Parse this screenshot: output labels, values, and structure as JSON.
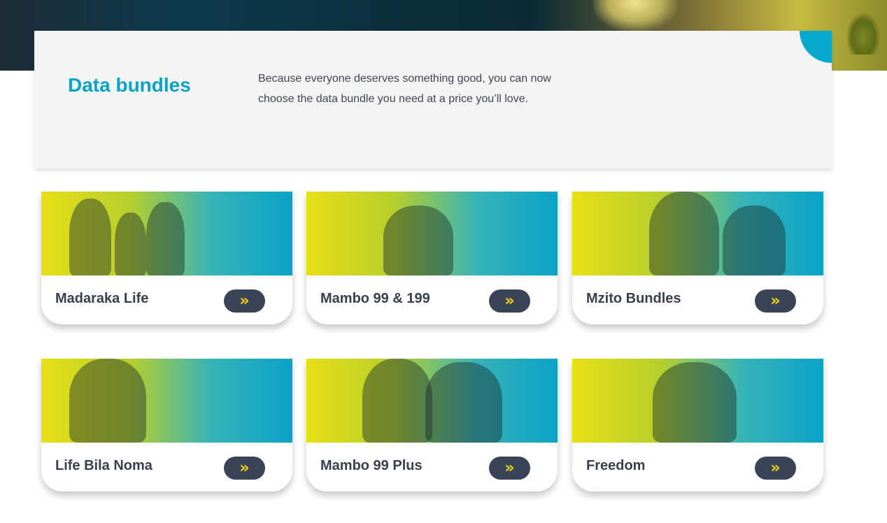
{
  "intro": {
    "title": "Data bundles",
    "description": "Because everyone deserves something good, you can now choose the data bundle you need at a price you’ll love."
  },
  "cards": [
    {
      "label": "Madaraka Life",
      "button_icon": "double-chevron-right-icon"
    },
    {
      "label": "Mambo 99 & 199",
      "button_icon": "double-chevron-right-icon"
    },
    {
      "label": "Mzito Bundles",
      "button_icon": "double-chevron-right-icon"
    },
    {
      "label": "Life Bila Noma",
      "button_icon": "double-chevron-right-icon"
    },
    {
      "label": "Mambo 99 Plus",
      "button_icon": "double-chevron-right-icon"
    },
    {
      "label": "Freedom",
      "button_icon": "double-chevron-right-icon"
    }
  ],
  "colors": {
    "accent": "#0aa3c7",
    "button_bg": "#3a4458",
    "button_icon": "#f3d311",
    "text_dark": "#3a3f4e"
  }
}
